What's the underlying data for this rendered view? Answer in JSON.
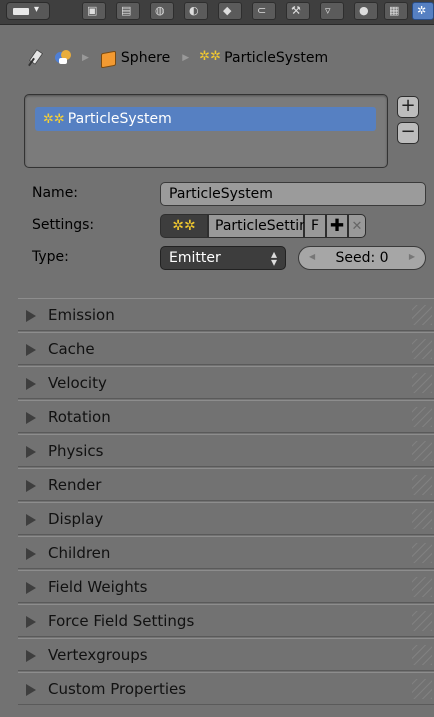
{
  "breadcrumb": {
    "object": "Sphere",
    "particle_system": "ParticleSystem"
  },
  "particle_list": {
    "selected_item": "ParticleSystem"
  },
  "properties": {
    "name_label": "Name:",
    "name_value": "ParticleSystem",
    "settings_label": "Settings:",
    "settings_value": "ParticleSettings",
    "settings_fake_user": "F",
    "type_label": "Type:",
    "type_value": "Emitter",
    "seed_value": "Seed: 0"
  },
  "panels": [
    {
      "label": "Emission"
    },
    {
      "label": "Cache"
    },
    {
      "label": "Velocity"
    },
    {
      "label": "Rotation"
    },
    {
      "label": "Physics"
    },
    {
      "label": "Render"
    },
    {
      "label": "Display"
    },
    {
      "label": "Children"
    },
    {
      "label": "Field Weights"
    },
    {
      "label": "Force Field Settings"
    },
    {
      "label": "Vertexgroups"
    },
    {
      "label": "Custom Properties"
    }
  ],
  "icons": {
    "pin": "pin-icon",
    "scene": "scene-icon",
    "object": "object-icon",
    "particles": "particles-icon",
    "add": "add-icon",
    "remove": "remove-icon",
    "unlink": "unlink-icon",
    "collapsed": "disclosure-triangle-icon"
  },
  "colors": {
    "background": "#727272",
    "selection": "#5680c2",
    "particle_icon": "#f3ca2f"
  }
}
